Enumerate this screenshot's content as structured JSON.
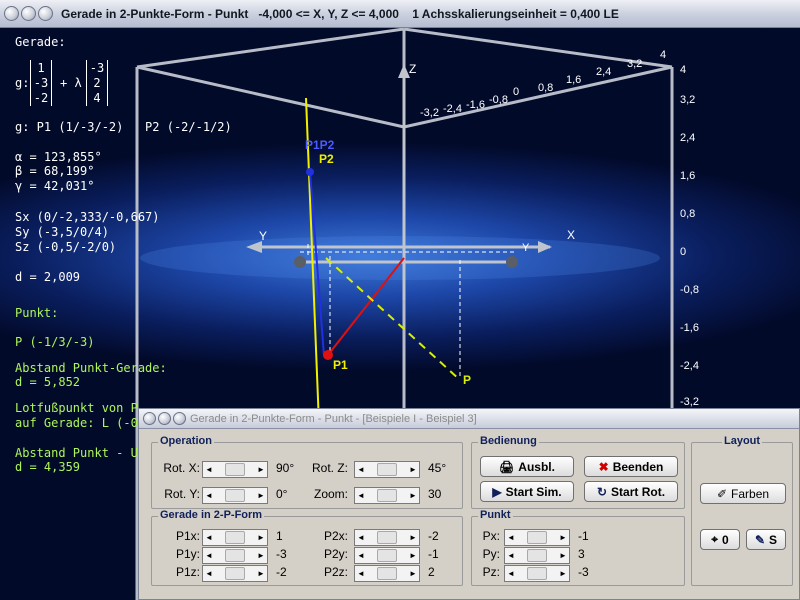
{
  "main_window": {
    "title": "Gerade in 2-Punkte-Form - Punkt   -4,000 <= X, Y, Z <= 4,000    1 Achsskalierungseinheit = 0,400 LE"
  },
  "info": {
    "gerade_heading": "Gerade:",
    "g_prefix": "g:",
    "plus_lambda": "+ λ",
    "vec_p": [
      "1",
      "-3",
      "-2"
    ],
    "vec_d": [
      "-3",
      "2",
      "4"
    ],
    "g_points": "g: P1 (1/-3/-2)   P2 (-2/-1/2)",
    "alpha": "α = 123,855°",
    "beta": "β = 68,199°",
    "gamma": "γ = 42,031°",
    "sx": "Sx (0/-2,333/-0,667)",
    "sy": "Sy (-3,5/0/4)",
    "sz": "Sz (-0,5/-2/0)",
    "d": "d = 2,009",
    "punkt_heading": "Punkt:",
    "punkt": "P (-1/3/-3)",
    "abstand_pg": "Abstand Punkt-Gerade:",
    "abstand_pg_val": "d = 5,852",
    "lotfuss1": "Lotfußpunkt von P",
    "lotfuss2": "auf Gerade: L (-0,",
    "abstand_pu": "Abstand Punkt - U",
    "abstand_pu_val": "d = 4,359"
  },
  "plot": {
    "z_axis_label": "Z",
    "x_axis_label": "X",
    "y_axis_label": "Y",
    "y_axis_label_right": "Y",
    "top_ticks": [
      "-3,2",
      "-2,4",
      "-1,6",
      "-0,8",
      "0",
      "0,8",
      "1,6",
      "2,4",
      "3,2",
      "4"
    ],
    "right_ticks": [
      "4",
      "3,2",
      "2,4",
      "1,6",
      "0,8",
      "0",
      "-0,8",
      "-1,6",
      "-2,4",
      "-3,2"
    ],
    "p1p2_label": "P1P2",
    "p2_label": "P2",
    "p1_label": "P1",
    "p_label": "P",
    "colors": {
      "line_g": "#f0f000",
      "p1p2_label": "#4a5cff",
      "direction": "#2030e0",
      "perp": "#e01010",
      "dashed": "#d8f000",
      "axes": "#b8bcc8"
    }
  },
  "dialog": {
    "title": "Gerade in 2-Punkte-Form - Punkt - [Beispiele I - Beispiel 3]",
    "operation": {
      "title": "Operation",
      "rot_x_label": "Rot. X:",
      "rot_x_val": "90°",
      "rot_y_label": "Rot. Y:",
      "rot_y_val": "0°",
      "rot_z_label": "Rot. Z:",
      "rot_z_val": "45°",
      "zoom_label": "Zoom:",
      "zoom_val": "30"
    },
    "gerade": {
      "title": "Gerade in 2-P-Form",
      "p1x_label": "P1x:",
      "p1x_val": "1",
      "p1y_label": "P1y:",
      "p1y_val": "-3",
      "p1z_label": "P1z:",
      "p1z_val": "-2",
      "p2x_label": "P2x:",
      "p2x_val": "-2",
      "p2y_label": "P2y:",
      "p2y_val": "-1",
      "p2z_label": "P2z:",
      "p2z_val": "2"
    },
    "bedienung": {
      "title": "Bedienung",
      "ausbl": "Ausbl.",
      "beenden": "Beenden",
      "start_sim": "Start Sim.",
      "start_rot": "Start Rot."
    },
    "punkt": {
      "title": "Punkt",
      "px_label": "Px:",
      "px_val": "-1",
      "py_label": "Py:",
      "py_val": "3",
      "pz_label": "Pz:",
      "pz_val": "-3"
    },
    "layout": {
      "title": "Layout",
      "farben": "Farben",
      "zero_btn": "0",
      "s_btn": "S"
    }
  }
}
